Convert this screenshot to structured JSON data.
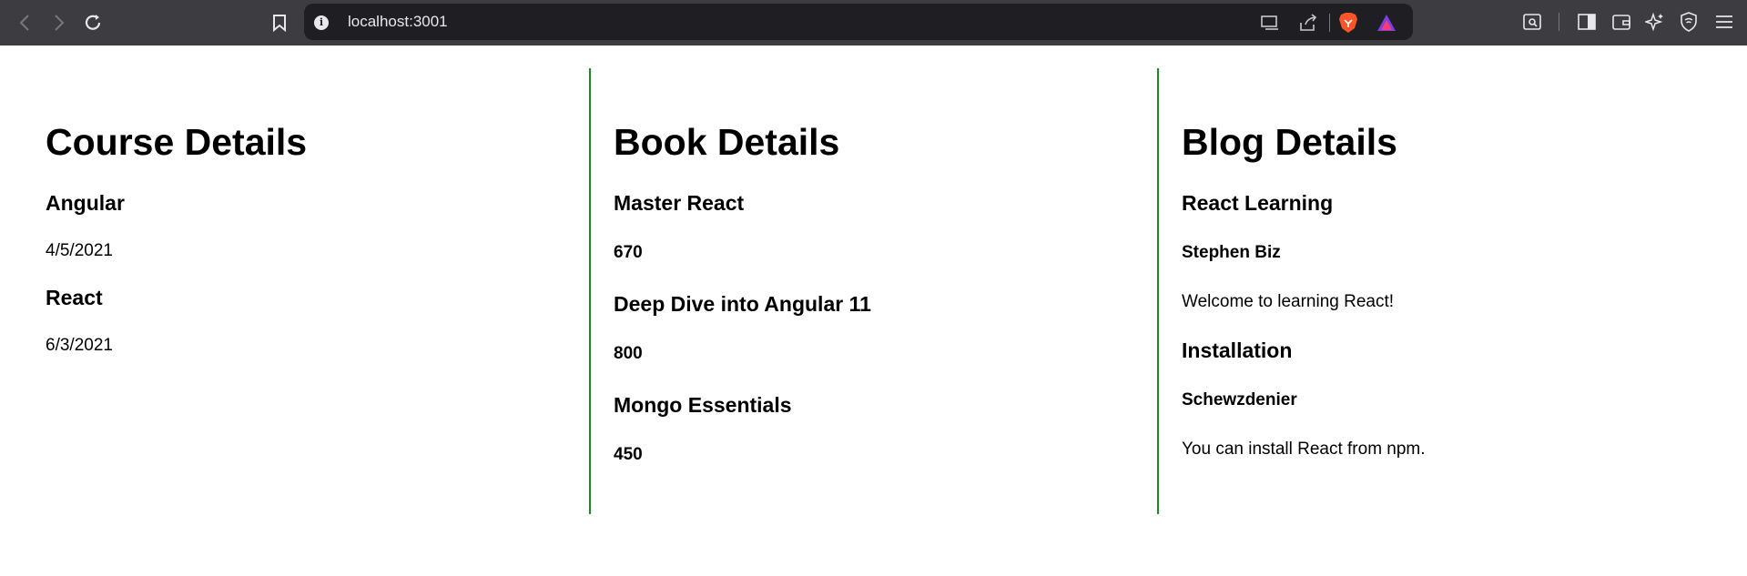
{
  "browser": {
    "url": "localhost:3001",
    "icons": {
      "back": "back-arrow-icon",
      "forward": "forward-arrow-icon",
      "reload": "reload-icon",
      "bookmark": "bookmark-icon",
      "site_info": "info-icon",
      "cast": "cast-icon",
      "share": "share-icon",
      "brave_shield": "brave-lion-icon",
      "rewards": "brave-rewards-icon",
      "search_tabs": "tab-search-icon",
      "sidebar": "sidebar-icon",
      "wallet": "wallet-icon",
      "leo": "leo-ai-icon",
      "vpn": "vpn-shield-icon",
      "menu": "hamburger-menu-icon"
    }
  },
  "courses": {
    "title": "Course Details",
    "items": [
      {
        "name": "Angular",
        "date": "4/5/2021"
      },
      {
        "name": "React",
        "date": "6/3/2021"
      }
    ]
  },
  "books": {
    "title": "Book Details",
    "items": [
      {
        "name": "Master React",
        "price": "670"
      },
      {
        "name": "Deep Dive into Angular 11",
        "price": "800"
      },
      {
        "name": "Mongo Essentials",
        "price": "450"
      }
    ]
  },
  "blogs": {
    "title": "Blog Details",
    "items": [
      {
        "title": "React Learning",
        "author": "Stephen Biz",
        "content": "Welcome to learning React!"
      },
      {
        "title": "Installation",
        "author": "Schewzdenier",
        "content": "You can install React from npm."
      }
    ]
  },
  "colors": {
    "divider": "#1a8a1a",
    "chrome_bg": "#3c3c41",
    "omnibox_bg": "#1f1f23"
  }
}
